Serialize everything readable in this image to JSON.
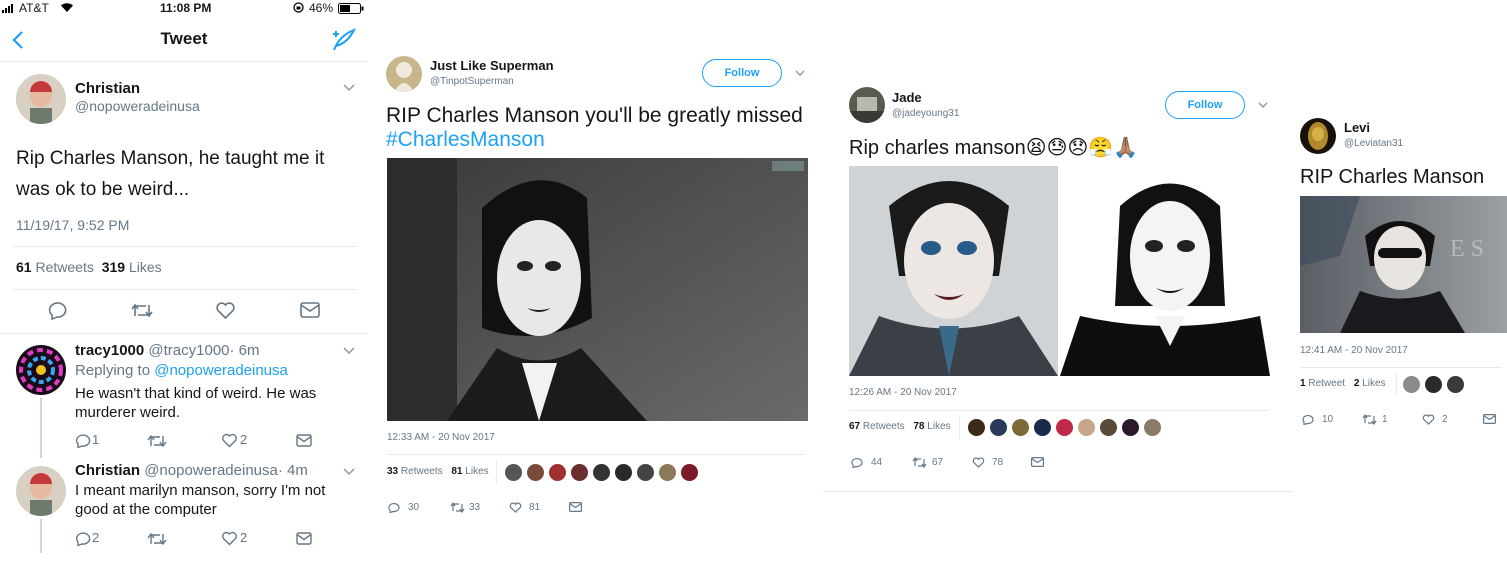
{
  "phone": {
    "status": {
      "carrier": "AT&T",
      "time": "11:08 PM",
      "battery": "46%"
    },
    "nav_title": "Tweet",
    "tweet": {
      "name": "Christian",
      "handle": "@nopoweradeinusa",
      "text_line1": "Rip Charles Manson, he taught me it",
      "text_line2": "was ok to be weird...",
      "timestamp": "11/19/17, 9:52 PM",
      "retweets_count": "61",
      "retweets_label": "Retweets",
      "likes_count": "319",
      "likes_label": "Likes"
    },
    "replies": [
      {
        "name": "tracy1000",
        "handle": "@tracy1000",
        "age": "· 6m",
        "replying_prefix": "Replying to",
        "replying_handle": "@nopoweradeinusa",
        "line1": "He wasn't that kind of weird. He was",
        "line2": "murderer weird.",
        "replies": "1",
        "likes": "2"
      },
      {
        "name": "Christian",
        "handle": "@nopoweradeinusa",
        "age": "· 4m",
        "line1": "I meant marilyn manson, sorry I'm not",
        "line2": "good at the computer",
        "replies": "2",
        "likes": "2"
      }
    ]
  },
  "web_tweets": [
    {
      "name": "Just Like Superman",
      "handle": "@TinpotSuperman",
      "follow_label": "Follow",
      "text": "RIP Charles Manson you'll be greatly missed",
      "hashtag": "#CharlesManson",
      "timestamp": "12:33 AM - 20 Nov 2017",
      "retweets_count": "33",
      "retweets_label": "Retweets",
      "likes_count": "81",
      "likes_label": "Likes",
      "reply_count": "30",
      "retweet_action_count": "33",
      "like_action_count": "81"
    },
    {
      "name": "Jade",
      "handle": "@jadeyoung31",
      "follow_label": "Follow",
      "text": "Rip charles manson😫😓😞😤🙏🏽",
      "timestamp": "12:26 AM - 20 Nov 2017",
      "retweets_count": "67",
      "retweets_label": "Retweets",
      "likes_count": "78",
      "likes_label": "Likes",
      "reply_count": "44",
      "retweet_action_count": "67",
      "like_action_count": "78"
    },
    {
      "name": "Levi",
      "handle": "@Leviatan31",
      "text": "RIP Charles Manson",
      "timestamp": "12:41 AM - 20 Nov 2017",
      "retweets_count": "1",
      "retweets_label": "Retweet",
      "likes_count": "2",
      "likes_label": "Likes",
      "reply_count": "10",
      "retweet_action_count": "1",
      "like_action_count": "2"
    }
  ],
  "colors": {
    "accent": "#1da1f2",
    "text": "#14171a",
    "muted": "#657786",
    "separator": "#e6ecf0"
  },
  "icons": [
    "back-chevron-icon",
    "compose-icon",
    "reply-icon",
    "retweet-icon",
    "like-icon",
    "message-icon",
    "caret-down-icon"
  ]
}
